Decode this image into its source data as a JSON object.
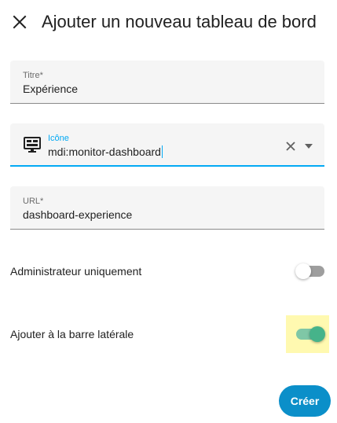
{
  "dialog": {
    "title": "Ajouter un nouveau tableau de bord"
  },
  "fields": {
    "title": {
      "label": "Titre*",
      "value": "Expérience"
    },
    "icon": {
      "label": "Icône",
      "value": "mdi:monitor-dashboard",
      "icon_name": "monitor-dashboard-icon"
    },
    "url": {
      "label": "URL*",
      "value": "dashboard-experience"
    }
  },
  "toggles": {
    "admin_only": {
      "label": "Administrateur uniquement",
      "checked": false
    },
    "sidebar": {
      "label": "Ajouter à la barre latérale",
      "checked": true
    }
  },
  "actions": {
    "create_label": "Créer"
  },
  "colors": {
    "accent": "#03a9f4",
    "primary_button": "#0b8fc9",
    "switch_on": "#46b38a",
    "highlight": "#fff9b0"
  }
}
